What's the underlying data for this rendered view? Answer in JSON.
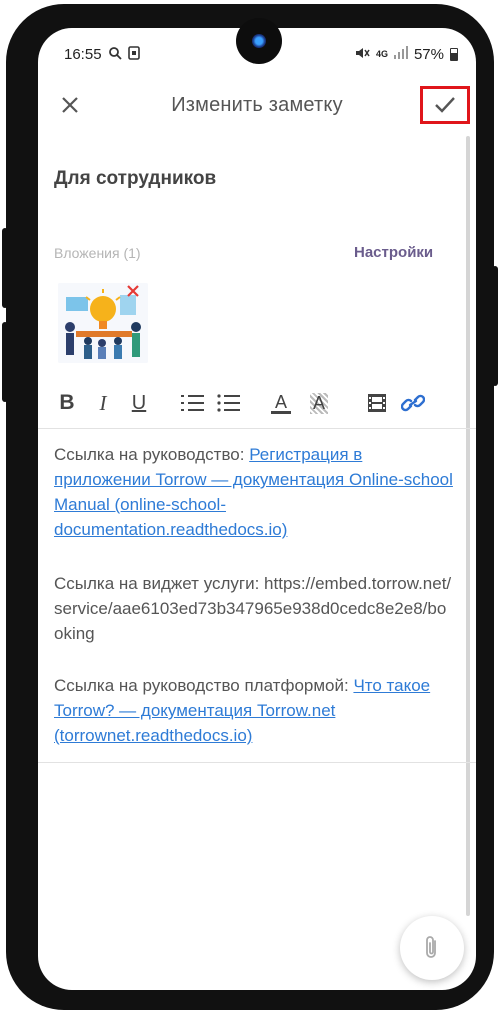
{
  "status_bar": {
    "time": "16:55",
    "network": "4G",
    "battery": "57%"
  },
  "app_bar": {
    "title": "Изменить заметку",
    "close_icon": "close-icon",
    "confirm_icon": "check-icon",
    "highlight_color": "#e0161b"
  },
  "note": {
    "title": "Для сотрудников",
    "attachments_label": "Вложения (1)",
    "settings_label": "Настройки",
    "attachment_icon": "image-thumbnail"
  },
  "toolbar": {
    "items": [
      "bold-icon",
      "italic-icon",
      "underline-icon",
      "numbered-list-icon",
      "bullet-list-icon",
      "text-color-icon",
      "highlight-icon",
      "video-icon",
      "link-icon"
    ],
    "bold": "B",
    "italic": "I",
    "underline": "U",
    "text_color": "A",
    "highlight": "A"
  },
  "content": {
    "p1_text": "Ссылка на руководство: ",
    "p1_link": "Регистрация в приложении Torrow — документация Online-school Manual (online-school-documentation.readthedocs.io)",
    "p2_text": "Ссылка на виджет услуги: https://embed.torrow.net/service/aae6103ed73b347965e938d0cedc8e2e8/booking",
    "p3_text": "Ссылка на руководство платформой: ",
    "p3_link": "Что такое Torrow? — документация Torrow.net (torrownet.readthedocs.io)",
    "link_color": "#2e7bd6"
  },
  "fab": {
    "icon": "paperclip-icon"
  }
}
